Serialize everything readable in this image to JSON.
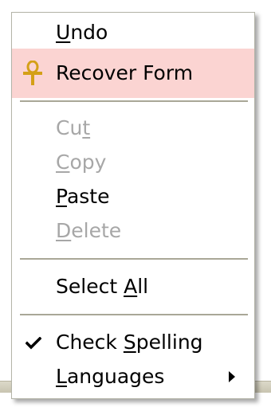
{
  "menu": {
    "undo": {
      "pre": "",
      "ul": "U",
      "post": "ndo"
    },
    "recover": {
      "pre": "Recover Form",
      "ul": "",
      "post": "",
      "icon": "ankh-icon",
      "highlight_color": "#fbd4d2",
      "icon_color": "#d4a017"
    },
    "cut": {
      "pre": "Cu",
      "ul": "t",
      "post": ""
    },
    "copy": {
      "pre": "",
      "ul": "C",
      "post": "opy"
    },
    "paste": {
      "pre": "",
      "ul": "P",
      "post": "aste"
    },
    "delete": {
      "pre": "",
      "ul": "D",
      "post": "elete"
    },
    "select_all": {
      "pre": "Select ",
      "ul": "A",
      "post": "ll"
    },
    "check_spelling": {
      "pre": "Check ",
      "ul": "S",
      "post": "pelling",
      "checked": true,
      "icon": "checkmark-icon"
    },
    "languages": {
      "pre": "",
      "ul": "L",
      "post": "anguages",
      "icon": "submenu-arrow-icon"
    }
  },
  "colors": {
    "disabled_text": "#a7a7a7",
    "separator": "#a9a797",
    "border": "#b4b4a8"
  }
}
